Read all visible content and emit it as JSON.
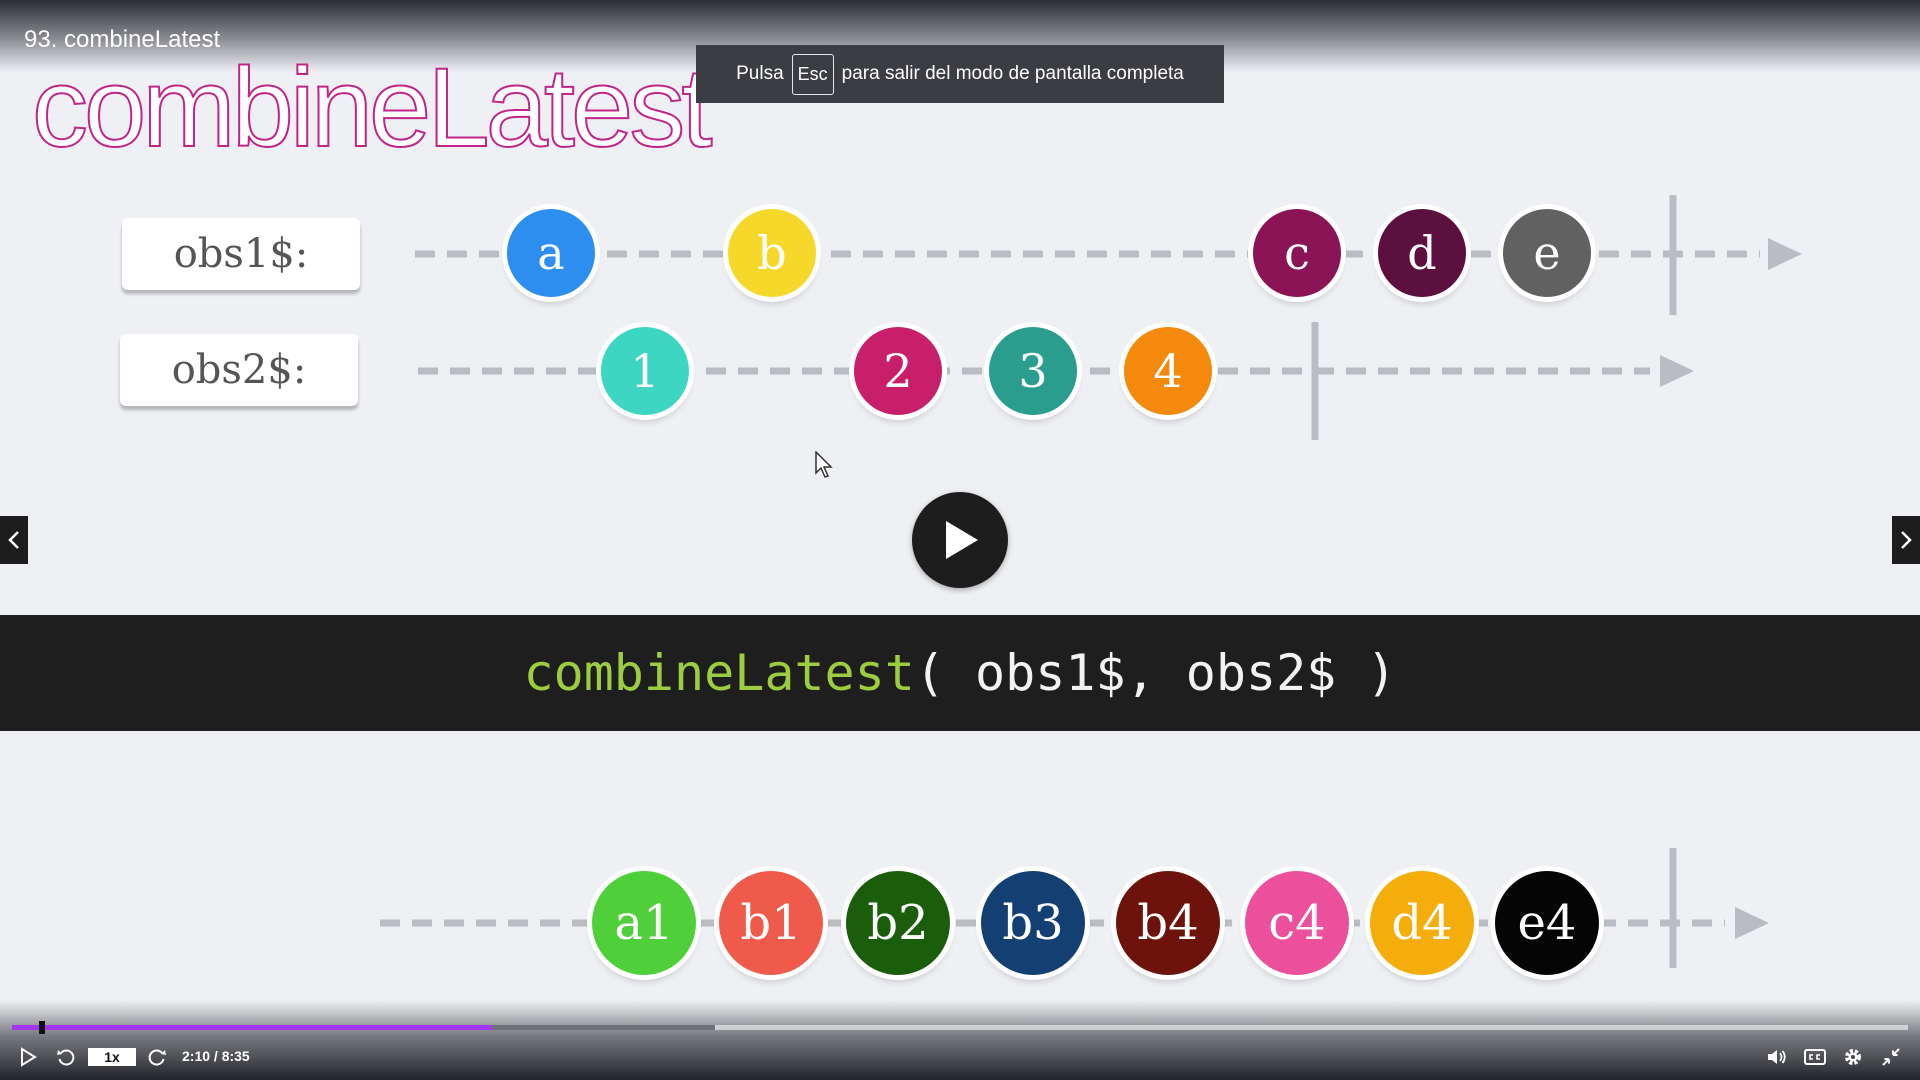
{
  "header": {
    "lesson_title": "93. combineLatest",
    "big_title": "combineLatest"
  },
  "fullscreen_notice": {
    "before": "Pulsa",
    "key": "Esc",
    "after": "para salir del modo de pantalla completa"
  },
  "diagram": {
    "obs1": {
      "label": "obs1$:",
      "marbles": [
        {
          "text": "a",
          "color": "#2e8ef0"
        },
        {
          "text": "b",
          "color": "#f5d82a"
        },
        {
          "text": "c",
          "color": "#8b1457"
        },
        {
          "text": "d",
          "color": "#5c1040"
        },
        {
          "text": "e",
          "color": "#616161"
        }
      ]
    },
    "obs2": {
      "label": "obs2$:",
      "marbles": [
        {
          "text": "1",
          "color": "#3dd6c2"
        },
        {
          "text": "2",
          "color": "#c81f6b"
        },
        {
          "text": "3",
          "color": "#2a9d8f"
        },
        {
          "text": "4",
          "color": "#f5890c"
        }
      ]
    },
    "code": {
      "fn": "combineLatest",
      "args": "( obs1$, obs2$ )"
    },
    "result": {
      "marbles": [
        {
          "text": "a1",
          "color": "#4fcf3a"
        },
        {
          "text": "b1",
          "color": "#f05a4b"
        },
        {
          "text": "b2",
          "color": "#1a5e0c"
        },
        {
          "text": "b3",
          "color": "#143f73"
        },
        {
          "text": "b4",
          "color": "#6e120c"
        },
        {
          "text": "c4",
          "color": "#ec4f9c"
        },
        {
          "text": "d4",
          "color": "#f4ad0a"
        },
        {
          "text": "e4",
          "color": "#050505"
        }
      ]
    }
  },
  "player": {
    "speed": "1x",
    "time": "2:10 / 8:35",
    "progress_fraction": 0.253,
    "buffered_fraction": 0.371,
    "colors": {
      "progress": "#a435f0"
    }
  }
}
